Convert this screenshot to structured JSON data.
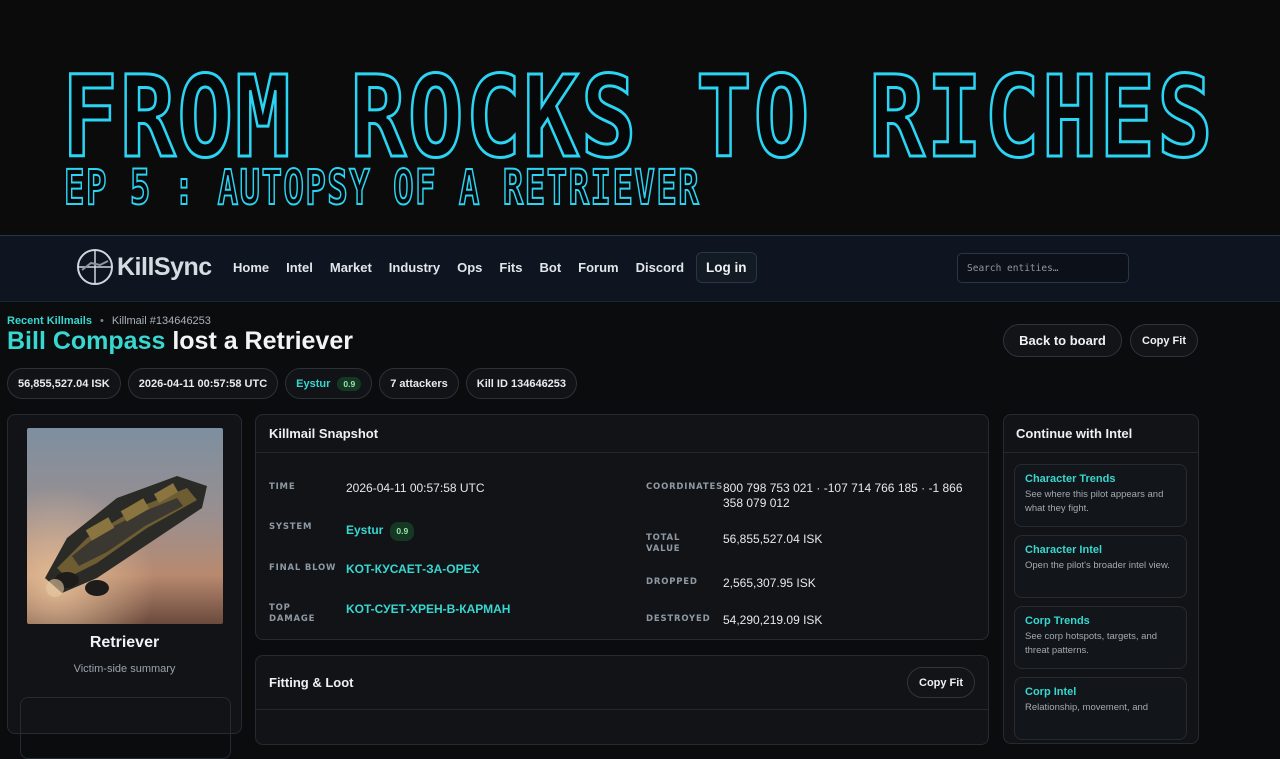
{
  "banner": {
    "title": "FROM ROCKS TO RICHES",
    "subtitle": "EP 5 : AUTOPSY OF A RETRIEVER"
  },
  "nav": {
    "logo": "KillSync",
    "links": [
      "Home",
      "Intel",
      "Market",
      "Industry",
      "Ops",
      "Fits",
      "Bot",
      "Forum",
      "Discord"
    ],
    "login": "Log in",
    "search_placeholder": "Search entities…"
  },
  "breadcrumb": {
    "link": "Recent Killmails",
    "sep": "•",
    "current": "Killmail #134646253"
  },
  "header": {
    "victim": "Bill Compass",
    "title_rest": " lost a Retriever",
    "back_button": "Back to board",
    "copy_button": "Copy Fit"
  },
  "pills": {
    "value": "56,855,527.04 ISK",
    "time": "2026-04-11 00:57:58 UTC",
    "system": "Eystur",
    "security": "0.9",
    "attackers": "7 attackers",
    "kill_id": "Kill ID 134646253"
  },
  "ship": {
    "name": "Retriever",
    "subtitle": "Victim-side summary"
  },
  "snapshot": {
    "title": "Killmail Snapshot",
    "time_label": "TIME",
    "time": "2026-04-11 00:57:58 UTC",
    "system_label": "SYSTEM",
    "system": "Eystur",
    "security": "0.9",
    "final_blow_label": "FINAL BLOW",
    "final_blow": "KOT-КУСАЕТ-ЗА-ОРЕХ",
    "top_damage_label_1": "TOP",
    "top_damage_label_2": "DAMAGE",
    "top_damage": "KOT-СУЕТ-ХРЕН-В-КАРМАН",
    "coordinates_label": "COORDINATES",
    "coordinates_1": "800 798 753 021 · -107 714 766 185 · -1 866",
    "coordinates_2": "358 079 012",
    "total_label_1": "TOTAL",
    "total_label_2": "VALUE",
    "total_value": "56,855,527.04 ISK",
    "dropped_label": "DROPPED",
    "dropped": "2,565,307.95 ISK",
    "destroyed_label": "DESTROYED",
    "destroyed": "54,290,219.09 ISK"
  },
  "fitting": {
    "title": "Fitting & Loot",
    "copy_button": "Copy Fit"
  },
  "intel": {
    "title": "Continue with Intel",
    "cards": [
      {
        "title": "Character Trends",
        "desc": "See where this pilot appears and what they fight."
      },
      {
        "title": "Character Intel",
        "desc": "Open the pilot's broader intel view."
      },
      {
        "title": "Corp Trends",
        "desc": "See corp hotspots, targets, and threat patterns."
      },
      {
        "title": "Corp Intel",
        "desc": "Relationship, movement, and"
      }
    ]
  },
  "colors": {
    "accent": "#38d7d0",
    "banner_outline": "#2bd4f2",
    "security_badge": "#143823"
  }
}
